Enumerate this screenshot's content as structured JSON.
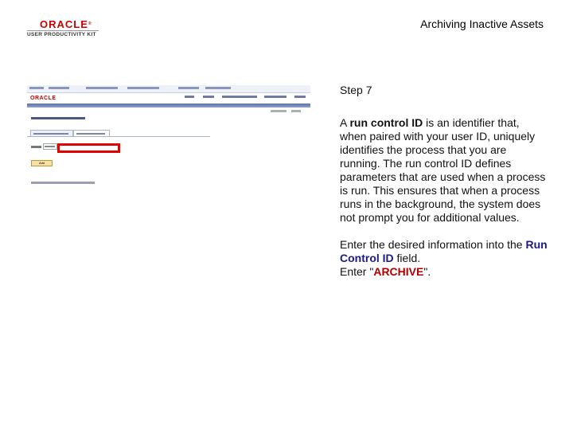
{
  "logo": {
    "brand": "ORACLE",
    "product": "USER PRODUCTIVITY KIT"
  },
  "document_title": "Archiving Inactive Assets",
  "screenshot": {
    "app_logo": "ORACLE",
    "highlight_color": "#e00000",
    "add_button": "Add"
  },
  "instructions": {
    "step": "Step 7",
    "intro_prefix": "A ",
    "intro_term": "run control ID",
    "intro_body": " is an identifier that, when paired with your user ID, uniquely identifies the process that you are running. The run control ID defines parameters that are used when a process is run. This ensures that when a process runs in the background, the system does not prompt you for additional values.",
    "action_prefix": "Enter the desired information into the ",
    "field_name": "Run Control ID",
    "action_suffix": " field.",
    "enter_prefix": "Enter \"",
    "enter_value": "ARCHIVE",
    "enter_suffix": "\"."
  },
  "colors": {
    "field_name": "#1a1a8c",
    "enter_value": "#b00000",
    "oracle_red": "#cc0000"
  }
}
